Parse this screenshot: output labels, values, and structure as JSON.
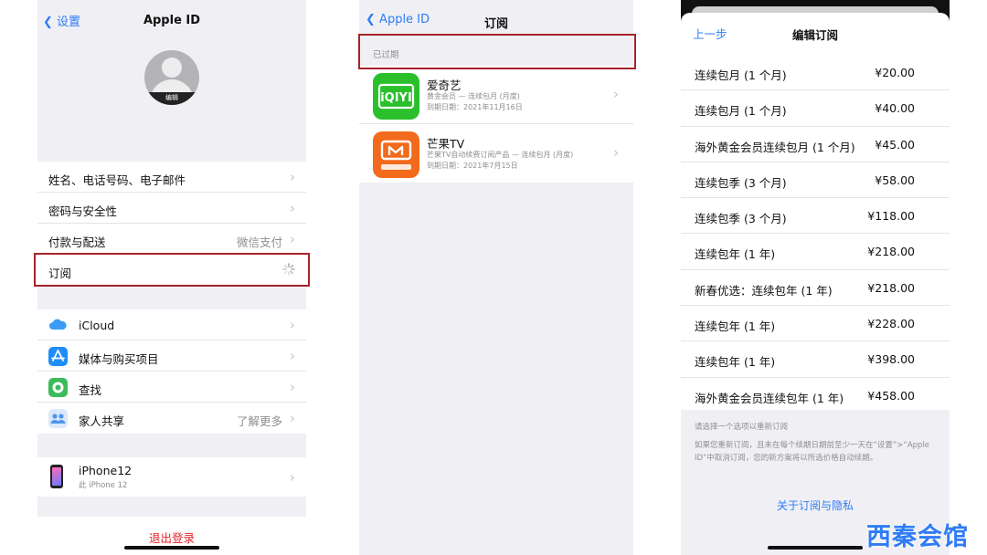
{
  "screen1": {
    "back_label": "设置",
    "title": "Apple ID",
    "avatar_edit": "编辑",
    "group1": [
      {
        "label": "姓名、电话号码、电子邮件",
        "value": ""
      },
      {
        "label": "密码与安全性",
        "value": ""
      },
      {
        "label": "付款与配送",
        "value": "微信支付"
      },
      {
        "label": "订阅",
        "value": ""
      }
    ],
    "group2": [
      {
        "label": "iCloud",
        "value": "",
        "icon": "cloud-icon"
      },
      {
        "label": "媒体与购买项目",
        "value": "",
        "icon": "app-store-icon"
      },
      {
        "label": "查找",
        "value": "",
        "icon": "find-my-icon"
      },
      {
        "label": "家人共享",
        "value": "了解更多",
        "icon": "family-sharing-icon"
      }
    ],
    "device": {
      "name": "iPhone12",
      "subtitle": "此 iPhone 12"
    },
    "sign_out": "退出登录"
  },
  "screen2": {
    "back_label": "Apple ID",
    "title": "订阅",
    "section": "已过期",
    "subscriptions": [
      {
        "name": "爱奇艺",
        "plan": "黄金会员 — 连续包月 (月度)",
        "expiry": "到期日期：2021年11月16日",
        "icon": "iqiyi-icon"
      },
      {
        "name": "芒果TV",
        "plan": "芒果TV自动续费订阅产品 — 连续包月 (月度)",
        "expiry": "到期日期：2021年7月15日",
        "icon": "mango-tv-icon"
      }
    ]
  },
  "screen3": {
    "back_label": "上一步",
    "title": "编辑订阅",
    "options": [
      {
        "name": "连续包月 (1 个月)",
        "price": "¥20.00"
      },
      {
        "name": "连续包月 (1 个月)",
        "price": "¥40.00"
      },
      {
        "name": "海外黄金会员连续包月 (1 个月)",
        "price": "¥45.00"
      },
      {
        "name": "连续包季 (3 个月)",
        "price": "¥58.00"
      },
      {
        "name": "连续包季 (3 个月)",
        "price": "¥118.00"
      },
      {
        "name": "连续包年 (1 年)",
        "price": "¥218.00"
      },
      {
        "name": "新春优选：连续包年 (1 年)",
        "price": "¥218.00"
      },
      {
        "name": "连续包年 (1 年)",
        "price": "¥228.00"
      },
      {
        "name": "连续包年 (1 年)",
        "price": "¥398.00"
      },
      {
        "name": "海外黄金会员连续包年 (1 年)",
        "price": "¥458.00"
      }
    ],
    "hint": "请选择一个选项以重新订阅",
    "note": "如果您重新订阅，且未在每个续期日期前至少一天在“设置”>“Apple ID”中取消订阅，您的新方案将以所选价格自动续期。",
    "privacy_link": "关于订阅与隐私"
  },
  "watermark": "西秦会馆",
  "colors": {
    "accent": "#2f7cf6",
    "highlight": "#a7232a",
    "destructive": "#e3262a"
  }
}
